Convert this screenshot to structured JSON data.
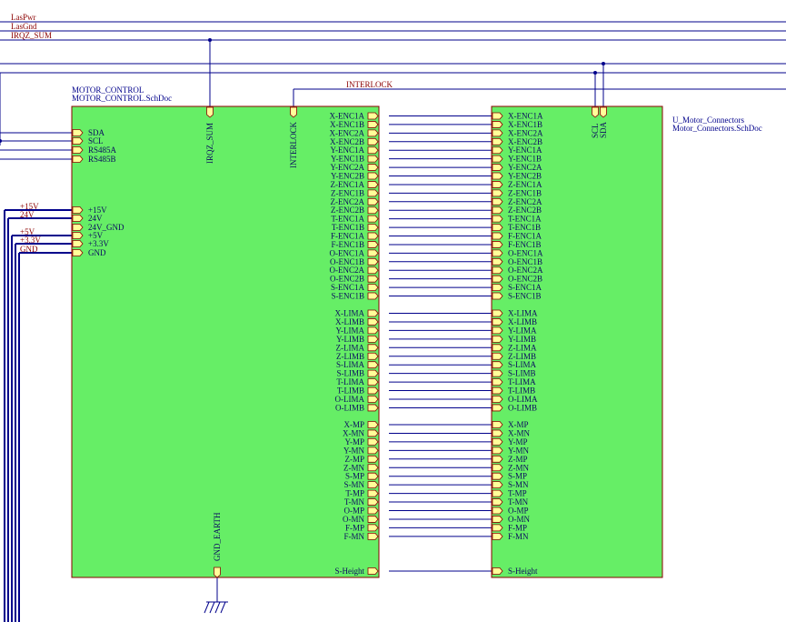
{
  "top_nets": [
    "LasPwr",
    "LasGnd",
    "IRQZ_SUM"
  ],
  "interlock_net": "INTERLOCK",
  "power_nets": [
    "+15V",
    "24V",
    "+5V",
    "+3.3V",
    "GND"
  ],
  "left_block": {
    "designator": "MOTOR_CONTROL",
    "filename": "MOTOR_CONTROL.SchDoc",
    "left_pins_comm": [
      "SDA",
      "SCL",
      "RS485A",
      "RS485B"
    ],
    "left_pins_power": [
      "+15V",
      "24V",
      "24V_GND",
      "+5V",
      "+3.3V",
      "GND"
    ],
    "top_pins": [
      "IRQZ_SUM",
      "INTERLOCK"
    ],
    "bottom_pins": [
      "GND_EARTH"
    ]
  },
  "right_block": {
    "designator": "U_Motor_Connectors",
    "filename": "Motor_Connectors.SchDoc",
    "top_pins": [
      "SCL",
      "SDA"
    ]
  },
  "encoder_pins": [
    "X-ENC1A",
    "X-ENC1B",
    "X-ENC2A",
    "X-ENC2B",
    "Y-ENC1A",
    "Y-ENC1B",
    "Y-ENC2A",
    "Y-ENC2B",
    "Z-ENC1A",
    "Z-ENC1B",
    "Z-ENC2A",
    "Z-ENC2B",
    "T-ENC1A",
    "T-ENC1B",
    "F-ENC1A",
    "F-ENC1B",
    "O-ENC1A",
    "O-ENC1B",
    "O-ENC2A",
    "O-ENC2B",
    "S-ENC1A",
    "S-ENC1B"
  ],
  "limit_pins": [
    "X-LIMA",
    "X-LIMB",
    "Y-LIMA",
    "Y-LIMB",
    "Z-LIMA",
    "Z-LIMB",
    "S-LIMA",
    "S-LIMB",
    "T-LIMA",
    "T-LIMB",
    "O-LIMA",
    "O-LIMB"
  ],
  "motor_pins": [
    "X-MP",
    "X-MN",
    "Y-MP",
    "Y-MN",
    "Z-MP",
    "Z-MN",
    "S-MP",
    "S-MN",
    "T-MP",
    "T-MN",
    "O-MP",
    "O-MN",
    "F-MP",
    "F-MN"
  ],
  "height_pin": "S-Height",
  "colors": {
    "block_fill": "#66ee66",
    "block_stroke": "#8b0000",
    "wire": "#00008b",
    "net_label": "#8b0000",
    "port_fill": "#ffff99"
  }
}
